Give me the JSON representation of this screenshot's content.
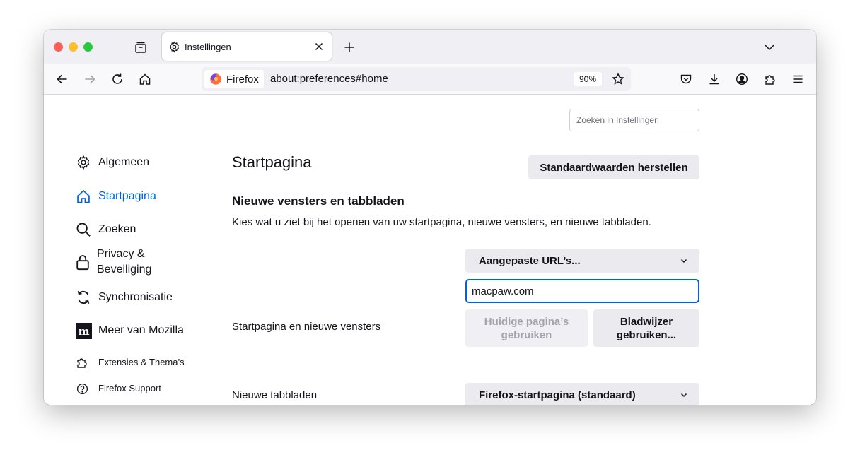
{
  "tab": {
    "title": "Instellingen"
  },
  "urlbar": {
    "identity_label": "Firefox",
    "url": "about:preferences#home",
    "zoom": "90%"
  },
  "search": {
    "placeholder": "Zoeken in Instellingen"
  },
  "sidebar": {
    "items": [
      {
        "label": "Algemeen",
        "icon": "gear-icon"
      },
      {
        "label": "Startpagina",
        "icon": "home-icon",
        "selected": true
      },
      {
        "label": "Zoeken",
        "icon": "search-icon"
      },
      {
        "label": "Privacy & Beveiliging",
        "icon": "lock-icon"
      },
      {
        "label": "Synchronisatie",
        "icon": "sync-icon"
      },
      {
        "label": "Meer van Mozilla",
        "icon": "mozilla-icon"
      }
    ],
    "footer": [
      {
        "label": "Extensies & Thema’s",
        "icon": "puzzle-icon"
      },
      {
        "label": "Firefox Support",
        "icon": "help-icon"
      }
    ]
  },
  "main": {
    "title": "Startpagina",
    "restore_label": "Standaardwaarden herstellen",
    "section_title": "Nieuwe vensters en tabbladen",
    "section_desc": "Kies wat u ziet bij het openen van uw startpagina, nieuwe vensters, en nieuwe tabbladen.",
    "homepage": {
      "label": "Startpagina en nieuwe vensters",
      "select_value": "Aangepaste URL’s...",
      "url_value": "macpaw.com",
      "use_current_label": "Huidige pagina’s gebruiken",
      "use_bookmark_label": "Bladwijzer gebruiken..."
    },
    "newtab": {
      "label": "Nieuwe tabbladen",
      "select_value": "Firefox-startpagina (standaard)"
    }
  },
  "colors": {
    "accent": "#0061e0",
    "close": "#fe5f57",
    "minimize": "#febc2e",
    "zoom": "#28c840"
  }
}
